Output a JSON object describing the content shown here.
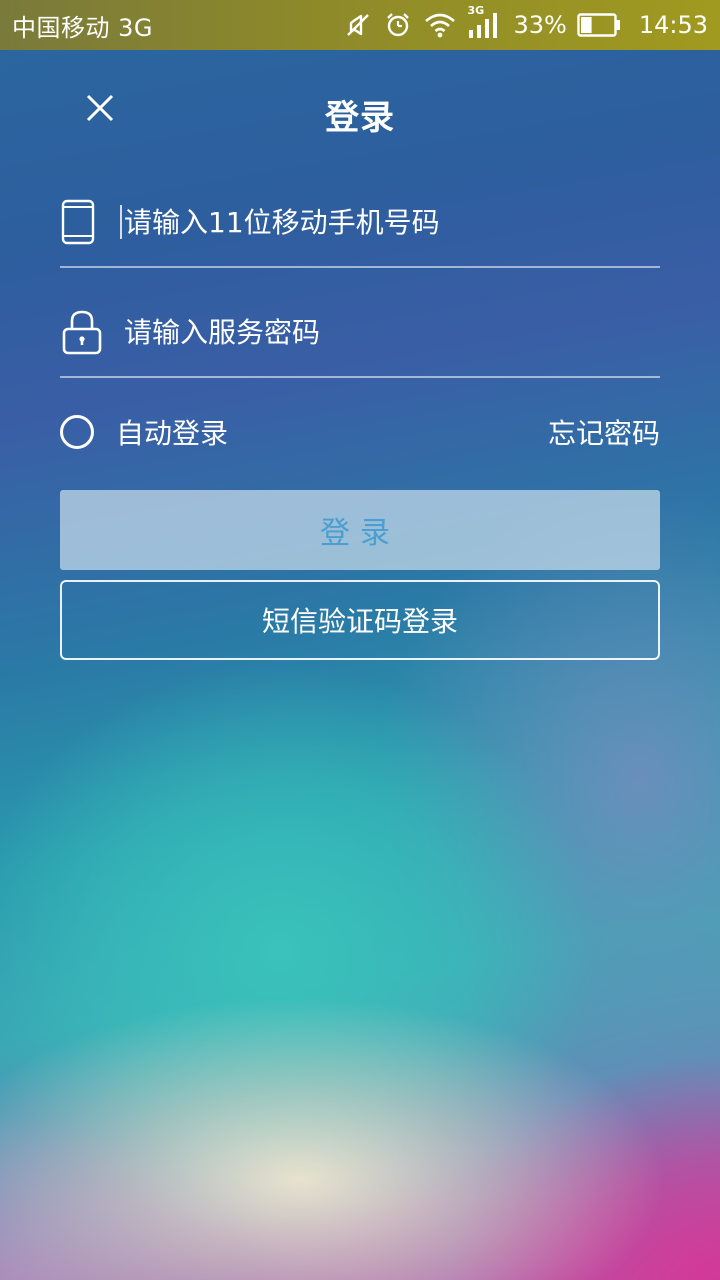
{
  "status_bar": {
    "carrier": "中国移动 3G",
    "network_badge": "3G",
    "battery_percent": "33%",
    "battery_level": 0.33,
    "time": "14:53",
    "icons": [
      "mute-icon",
      "alarm-icon",
      "wifi-icon",
      "signal-icon",
      "battery-icon"
    ]
  },
  "header": {
    "title": "登录",
    "close_icon": "close-icon"
  },
  "form": {
    "phone": {
      "placeholder": "请输入11位移动手机号码",
      "value": "",
      "icon": "phone-icon"
    },
    "password": {
      "placeholder": "请输入服务密码",
      "value": "",
      "icon": "lock-icon"
    },
    "auto_login": {
      "label": "自动登录",
      "checked": false
    },
    "forgot_password": "忘记密码",
    "login_button": "登录",
    "sms_login_button": "短信验证码登录"
  },
  "colors": {
    "status_bar": "#8e8a2a",
    "login_button_text": "#4a9ed0",
    "text": "#ffffff"
  }
}
